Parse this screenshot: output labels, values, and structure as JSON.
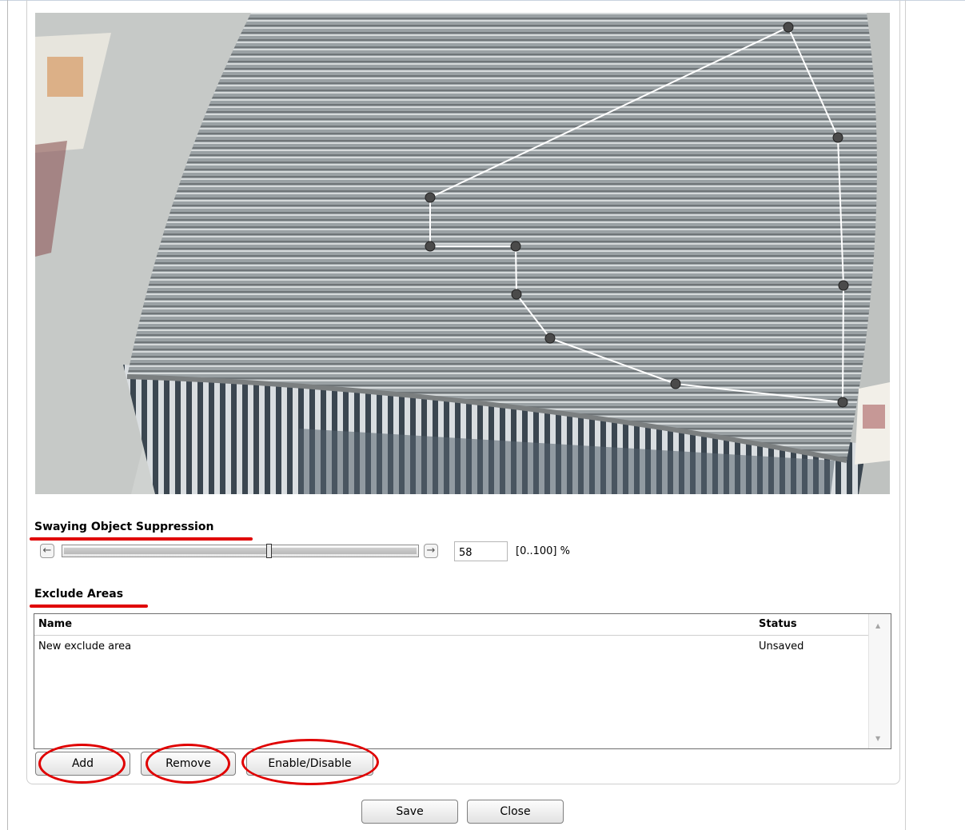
{
  "sway": {
    "title": "Swaying Object Suppression",
    "value": "58",
    "range_label": "[0..100] %",
    "level_percent": 58
  },
  "exclude": {
    "title": "Exclude Areas",
    "columns": {
      "name": "Name",
      "status": "Status"
    },
    "rows": [
      {
        "name": "New exclude area",
        "status": "Unsaved"
      }
    ],
    "buttons": {
      "add": "Add",
      "remove": "Remove",
      "toggle": "Enable/Disable"
    }
  },
  "footer": {
    "save": "Save",
    "close": "Close"
  },
  "icons": {
    "slider_left": "arrow-left-icon",
    "slider_right": "arrow-right-icon",
    "scroll_up": "scroll-up-icon",
    "scroll_down": "scroll-down-icon"
  },
  "colors": {
    "annotation": "#e00000",
    "polygon_line": "#ffffff",
    "polygon_vertex": "#4a4a4a"
  }
}
